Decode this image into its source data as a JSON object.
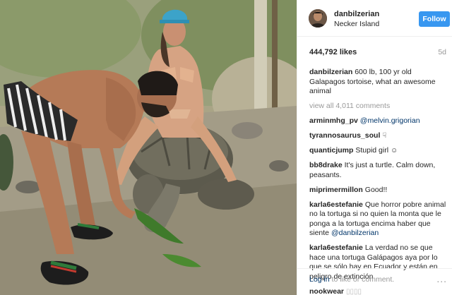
{
  "post": {
    "username": "danbilzerian",
    "location": "Necker Island",
    "follow_label": "Follow",
    "likes": "444,792 likes",
    "age": "5d",
    "caption_user": "danbilzerian",
    "caption_text": "600 lb, 100 yr old Galapagos tortoise, what an awesome animal",
    "view_all": "view all 4,011 comments"
  },
  "comments": [
    {
      "user": "arminmhg_pv",
      "text": "",
      "mention": "@melvin.grigorian"
    },
    {
      "user": "tyrannosaurus_soul",
      "text": "",
      "icon": "pointing-hand-icon"
    },
    {
      "user": "quanticjump",
      "text": "Stupid girl",
      "icon": "smiling-face-icon"
    },
    {
      "user": "bb8drake",
      "text": "It's just a turtle. Calm down, peasants."
    },
    {
      "user": "miprimermillon",
      "text": "Good!!"
    },
    {
      "user": "karla6estefanie",
      "text": "Que horror pobre animal no la tortuga si no quien la monta que le ponga a la tortuga encima haber que siente",
      "mention": "@danbilzerian"
    },
    {
      "user": "karla6estefanie",
      "text": "La verdad no se que hace una tortuga Galápagos aya por lo que se sólo hay en Ecuador y están en peligro de extinción"
    },
    {
      "user": "nookwear",
      "text": "",
      "icon": "emoji-placeholder-icon"
    }
  ],
  "footer": {
    "login_link": "Log in",
    "login_suffix": " to like or comment.",
    "more": "..."
  },
  "colors": {
    "follow_button": "#3897f0",
    "link": "#003569",
    "muted": "#999999"
  },
  "photo": {
    "description_icon": "photo-man-woman-tortoise"
  }
}
